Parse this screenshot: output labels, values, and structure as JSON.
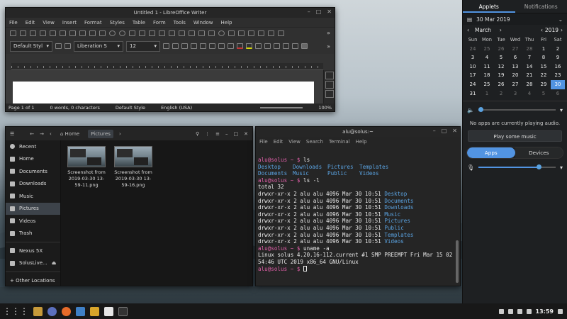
{
  "writer": {
    "title": "Untitled 1 - LibreOffice Writer",
    "menus": [
      "File",
      "Edit",
      "View",
      "Insert",
      "Format",
      "Styles",
      "Table",
      "Form",
      "Tools",
      "Window",
      "Help"
    ],
    "para_style": "Default Styl",
    "font_name": "Liberation S",
    "font_size": "12",
    "status": {
      "page": "Page 1 of 1",
      "words": "0 words, 0 characters",
      "style": "Default Style",
      "lang": "English (USA)",
      "zoom": "100%"
    }
  },
  "files": {
    "breadcrumb": [
      "Home",
      "Pictures"
    ],
    "sidebar": [
      "Recent",
      "Home",
      "Documents",
      "Downloads",
      "Music",
      "Pictures",
      "Videos",
      "Trash"
    ],
    "devices": [
      "Nexus 5X",
      "SolusLive..."
    ],
    "other": "+ Other Locations",
    "thumbs": [
      {
        "l1": "Screenshot from",
        "l2": "2019-03-30 13-",
        "l3": "59-11.png"
      },
      {
        "l1": "Screenshot from",
        "l2": "2019-03-30 13-",
        "l3": "59-16.png"
      }
    ]
  },
  "term": {
    "title": "alu@solus:~",
    "menus": [
      "File",
      "Edit",
      "View",
      "Search",
      "Terminal",
      "Help"
    ],
    "prompt": "alu@solus ~ $ ",
    "cmd1": "ls",
    "ls_row1": [
      "Desktop",
      "Downloads",
      "Pictures",
      "Templates"
    ],
    "ls_row2": [
      "Documents",
      "Music",
      "Public",
      "Videos"
    ],
    "cmd2": "ls -l",
    "total": "total 32",
    "perm": "drwxr-xr-x 2 alu alu 4096 Mar 30 10:51 ",
    "dirs": [
      "Desktop",
      "Documents",
      "Downloads",
      "Music",
      "Pictures",
      "Public",
      "Templates",
      "Videos"
    ],
    "cmd3": "uname -a",
    "uname1": "Linux solus 4.20.16-112.current #1 SMP PREEMPT Fri Mar 15 02:",
    "uname2": "54:46 UTC 2019 x86_64 GNU/Linux"
  },
  "panel": {
    "tab_applets": "Applets",
    "tab_notifications": "Notifications",
    "date": "30 Mar 2019",
    "month": "March",
    "year": "2019",
    "weekdays": [
      "Sun",
      "Mon",
      "Tue",
      "Wed",
      "Thu",
      "Fri",
      "Sat"
    ],
    "weeks": [
      [
        [
          "24",
          1
        ],
        [
          "25",
          1
        ],
        [
          "26",
          1
        ],
        [
          "27",
          1
        ],
        [
          "28",
          1
        ],
        [
          "1",
          0
        ],
        [
          "2",
          0
        ]
      ],
      [
        [
          "3",
          0
        ],
        [
          "4",
          0
        ],
        [
          "5",
          0
        ],
        [
          "6",
          0
        ],
        [
          "7",
          0
        ],
        [
          "8",
          0
        ],
        [
          "9",
          0
        ]
      ],
      [
        [
          "10",
          0
        ],
        [
          "11",
          0
        ],
        [
          "12",
          0
        ],
        [
          "13",
          0
        ],
        [
          "14",
          0
        ],
        [
          "15",
          0
        ],
        [
          "16",
          0
        ]
      ],
      [
        [
          "17",
          0
        ],
        [
          "18",
          0
        ],
        [
          "19",
          0
        ],
        [
          "20",
          0
        ],
        [
          "21",
          0
        ],
        [
          "22",
          0
        ],
        [
          "23",
          0
        ]
      ],
      [
        [
          "24",
          0
        ],
        [
          "25",
          0
        ],
        [
          "26",
          0
        ],
        [
          "27",
          0
        ],
        [
          "28",
          0
        ],
        [
          "29",
          0
        ],
        [
          "30",
          2
        ]
      ],
      [
        [
          "31",
          0
        ],
        [
          "1",
          1
        ],
        [
          "2",
          1
        ],
        [
          "3",
          1
        ],
        [
          "4",
          1
        ],
        [
          "5",
          1
        ],
        [
          "6",
          1
        ]
      ]
    ],
    "volume_level": 0.03,
    "mic_level": 0.78,
    "no_audio": "No apps are currently playing audio.",
    "play_music": "Play some music",
    "seg_apps": "Apps",
    "seg_devices": "Devices"
  },
  "taskbar": {
    "clock": "13:59"
  }
}
